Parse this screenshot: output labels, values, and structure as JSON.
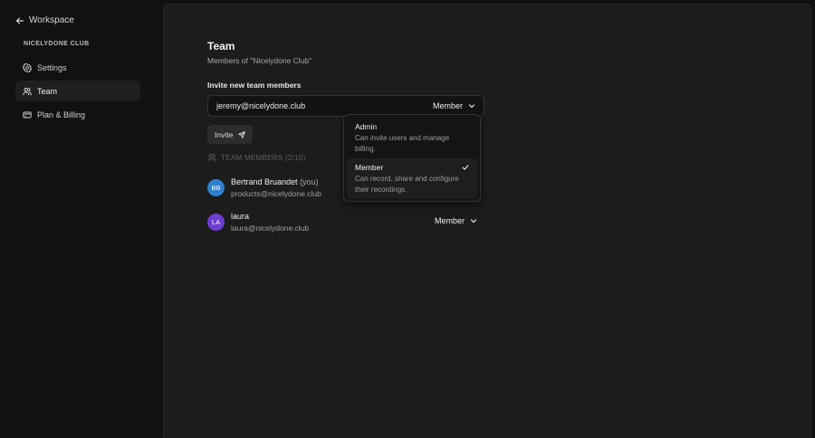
{
  "sidebar": {
    "back_label": "Workspace",
    "org_name": "NICELYDONE CLUB",
    "items": [
      {
        "label": "Settings",
        "icon": "gear-icon"
      },
      {
        "label": "Team",
        "icon": "users-icon",
        "active": true
      },
      {
        "label": "Plan & Billing",
        "icon": "credit-card-icon"
      }
    ]
  },
  "main": {
    "title": "Team",
    "subtitle": "Members of \"Nicelydone Club\"",
    "invite_label": "Invite new team members",
    "invite_input_value": "jeremy@nicelydone.club",
    "invite_role": "Member",
    "invite_button": "Invite",
    "members_header": "TEAM MEMBERS (2/10)",
    "members": [
      {
        "initials": "BB",
        "name": "Bertrand Bruandet",
        "you_tag": "(you)",
        "email": "products@nicelydone.club",
        "avatar_color": "#2f7fd0"
      },
      {
        "initials": "LA",
        "name": "laura",
        "email": "laura@nicelydone.club",
        "role": "Member",
        "avatar_color": "#6c3fcf"
      }
    ]
  },
  "dropdown": {
    "options": [
      {
        "title": "Admin",
        "description": "Can invite users and manage billing."
      },
      {
        "title": "Member",
        "description": "Can record, share and configure their recordings.",
        "selected": true
      }
    ]
  }
}
